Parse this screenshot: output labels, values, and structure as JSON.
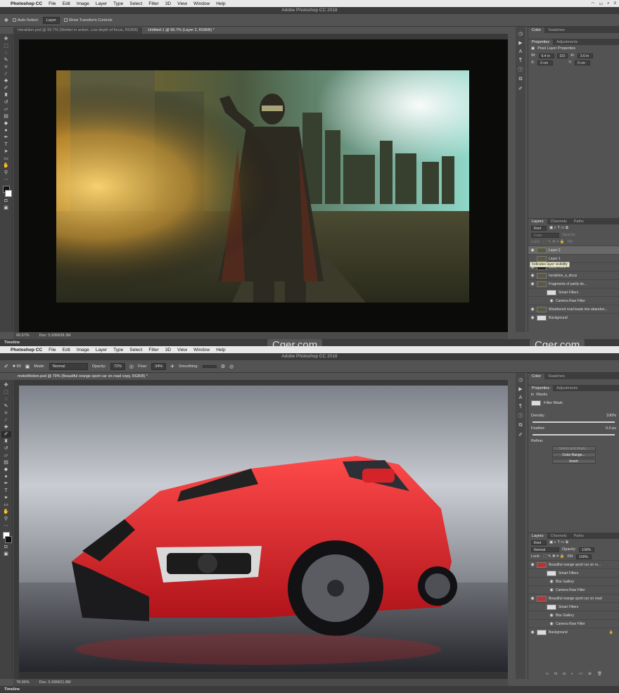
{
  "top": {
    "menubar": {
      "app": "Photoshop CC",
      "items": [
        "File",
        "Edit",
        "Image",
        "Layer",
        "Type",
        "Select",
        "Filter",
        "3D",
        "View",
        "Window",
        "Help"
      ]
    },
    "window_title": "Adobe Photoshop CC 2018",
    "options": {
      "auto_select_label": "Auto-Select:",
      "auto_select_value": "Layer",
      "show_transform": "Show Transform Controls"
    },
    "tabs": [
      "Heraklion.psd @ 66.7% (Welder in action. Low depth of focus, RGB/8)",
      "Untitled-1 @ 66.7% (Layer 2, RGB/8) *"
    ],
    "status": {
      "zoom": "66.67%",
      "doc": "Doc: 5.93M/38.3M"
    },
    "timeline": "Timeline",
    "panel_tabs": [
      "Color",
      "Swatches"
    ],
    "props_tabs": [
      "Properties",
      "Adjustments"
    ],
    "props_title": "Pixel Layer Properties",
    "props": {
      "w_label": "W:",
      "w": "6.4 in",
      "go": "GO",
      "h_label": "H:",
      "h": "3.6 in",
      "x_label": "X:",
      "x": "0 cm",
      "y_label": "Y:",
      "y": "0 cm"
    },
    "layers_tabs": [
      "Layers",
      "Channels",
      "Paths"
    ],
    "kind": "Kind",
    "blend": "Color",
    "opacity_label": "Opacity:",
    "lock_label": "Lock:",
    "fill_label": "Fill:",
    "tooltip": "Indicates layer visibility",
    "layers": [
      {
        "name": "Layer 2",
        "selected": true
      },
      {
        "name": "Layer 1",
        "selected": false
      },
      {
        "name": "Color Fill 1",
        "selected": false
      },
      {
        "name": "heraklion_a_dicus",
        "selected": false
      },
      {
        "name": "Fragments of partly de...",
        "selected": false
      },
      {
        "name": "Smart Filters",
        "selected": false
      },
      {
        "name": "Camera Raw Filter",
        "selected": false
      },
      {
        "name": "Weathered road leads into abandon...",
        "selected": false
      },
      {
        "name": "Background",
        "selected": false
      }
    ]
  },
  "bottom": {
    "menubar": {
      "app": "Photoshop CC",
      "items": [
        "File",
        "Edit",
        "Image",
        "Layer",
        "Type",
        "Select",
        "Filter",
        "3D",
        "View",
        "Window",
        "Help"
      ]
    },
    "window_title": "Adobe Photoshop CC 2018",
    "options": {
      "size": "80",
      "mode_label": "Mode:",
      "mode_value": "Normal",
      "opacity_label": "Opacity:",
      "opacity_value": "72%",
      "flow_label": "Flow:",
      "flow_value": "34%",
      "smoothing_label": "Smoothing:"
    },
    "tabs": [
      "motorMotion.psd @ 79% (Beautiful orange sport car on road copy, RGB/8) *"
    ],
    "status": {
      "zoom": "78.96%",
      "doc": "Doc: 5.93M/21.8M"
    },
    "timeline": "Timeline",
    "panel_tabs": [
      "Color",
      "Swatches"
    ],
    "props_tabs": [
      "Properties",
      "Adjustments"
    ],
    "masks_label": "Masks",
    "filter_mask": "Filter Mask",
    "density_label": "Density:",
    "density_value": "100%",
    "feather_label": "Feather:",
    "feather_value": "0.0 px",
    "refine_label": "Refine:",
    "btn_select_mask": "Select and Mask...",
    "btn_color_range": "Color Range...",
    "btn_invert": "Invert",
    "layers_tabs": [
      "Layers",
      "Channels",
      "Paths"
    ],
    "kind": "Kind",
    "blend": "Normal",
    "opacity_label": "Opacity:",
    "opacity_value": "100%",
    "lock_label": "Lock:",
    "fill_label": "Fill:",
    "fill_value": "100%",
    "layers": [
      {
        "name": "Beautiful orange sport car on ro...",
        "selected": false
      },
      {
        "name": "Smart Filters",
        "selected": false
      },
      {
        "name": "Blur Gallery",
        "selected": false
      },
      {
        "name": "Camera Raw Filter",
        "selected": false
      },
      {
        "name": "Beautiful orange sport car on road",
        "selected": false
      },
      {
        "name": "Smart Filters",
        "selected": false
      },
      {
        "name": "Blur Gallery",
        "selected": false
      },
      {
        "name": "Camera Raw Filter",
        "selected": false
      },
      {
        "name": "Background",
        "selected": false
      }
    ]
  },
  "watermark": "Cger.com"
}
